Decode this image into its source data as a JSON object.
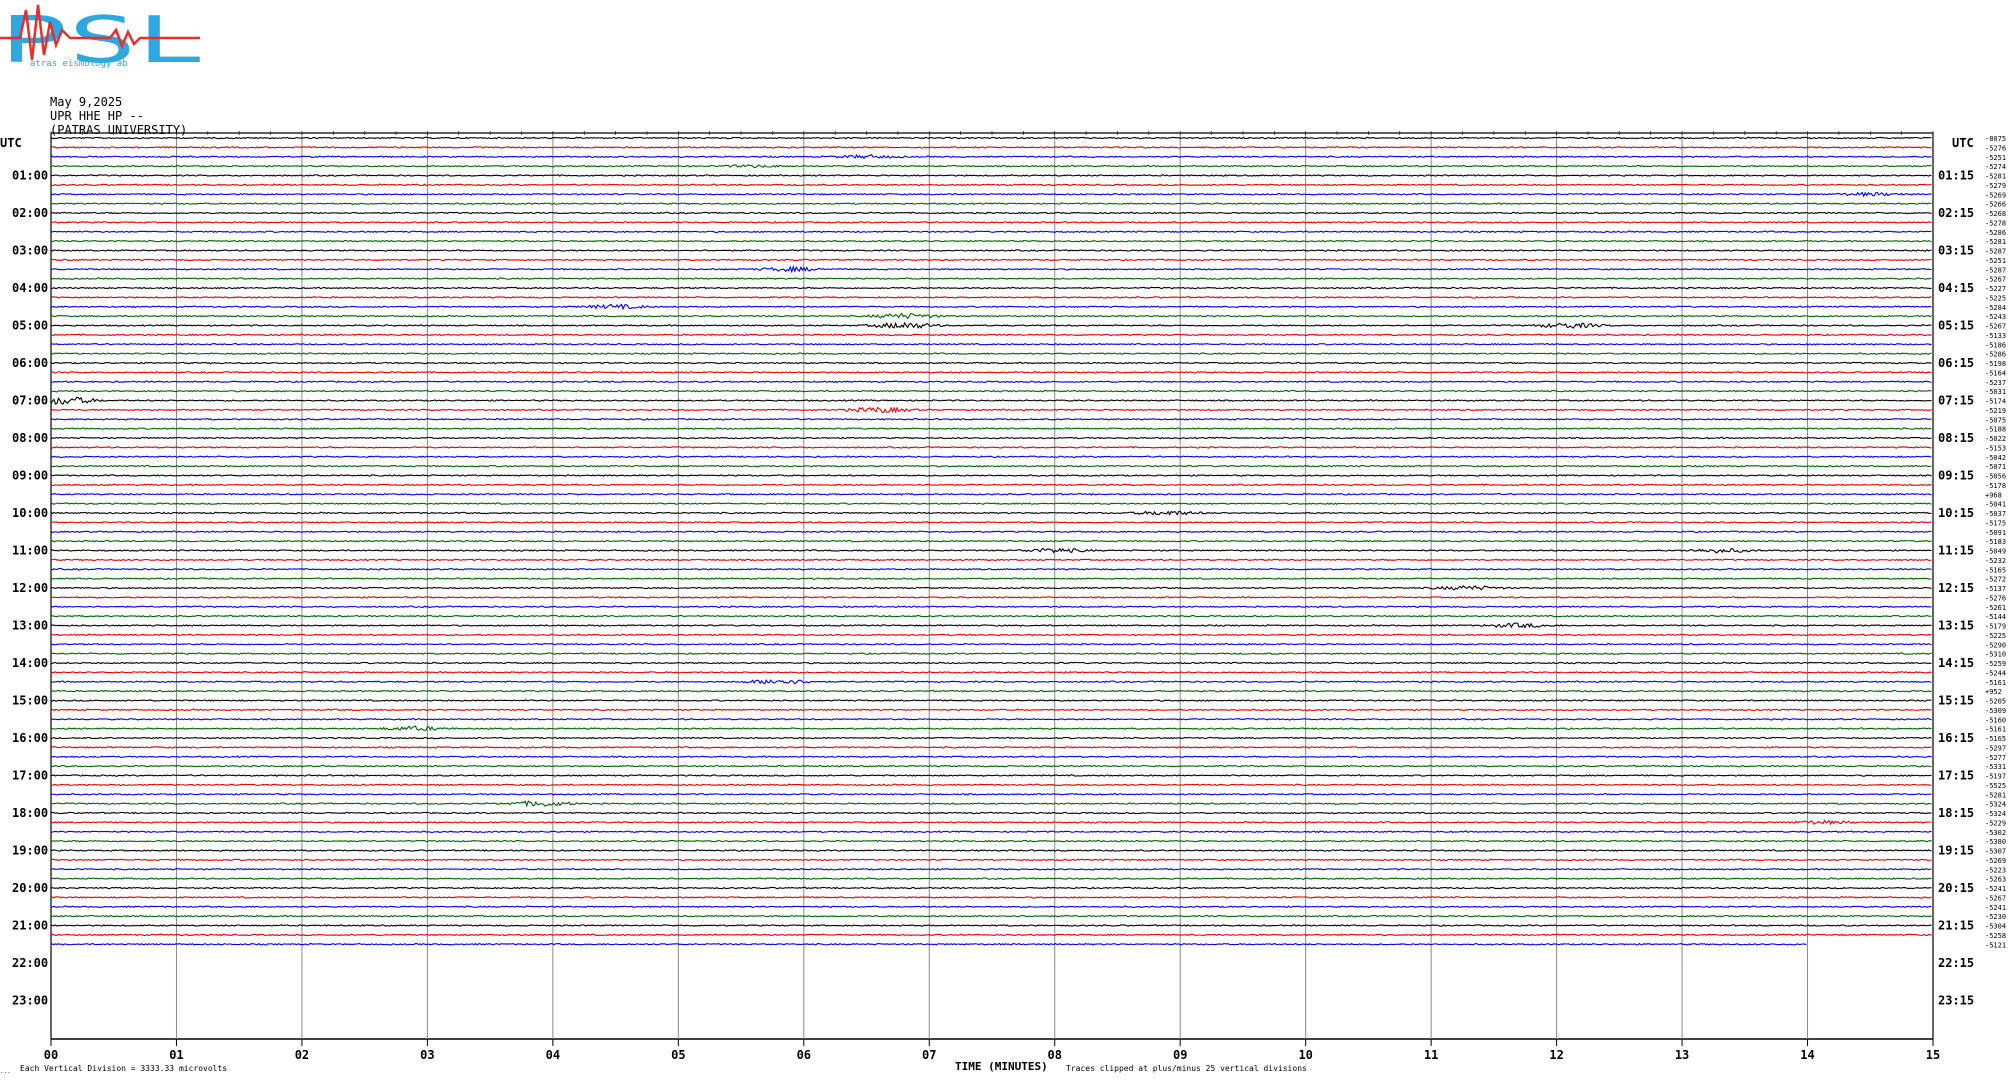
{
  "logo": {
    "letters": "PSL",
    "small_text": "atras eismology ab",
    "colors": {
      "p_s": "#2ea8e0",
      "l": "#2ea8e0",
      "wave": "#e03030"
    }
  },
  "header": {
    "date": "May 9,2025",
    "station": "UPR HHE HP --",
    "institution": "(PATRAS UNIVERSITY)"
  },
  "footer": {
    "scale_note": "Each Vertical Division = 3333.33 microvolts",
    "clip_note": "Traces clipped at plus/minus 25 vertical divisions",
    "corner_mark": "..."
  },
  "chart_data": {
    "type": "line",
    "title": "",
    "xlabel": "TIME (MINUTES)",
    "ylabel": "UTC",
    "right_ylabel": "UTC",
    "xlim": [
      0,
      15
    ],
    "x_ticks": [
      "00",
      "01",
      "02",
      "03",
      "04",
      "05",
      "06",
      "07",
      "08",
      "09",
      "10",
      "11",
      "12",
      "13",
      "14",
      "15"
    ],
    "left_hour_labels": [
      "01:00",
      "02:00",
      "03:00",
      "04:00",
      "05:00",
      "06:00",
      "07:00",
      "08:00",
      "09:00",
      "10:00",
      "11:00",
      "12:00",
      "13:00",
      "14:00",
      "15:00",
      "16:00",
      "17:00",
      "18:00",
      "19:00",
      "20:00",
      "21:00",
      "22:00",
      "23:00"
    ],
    "right_hour_labels": [
      "01:15",
      "02:15",
      "03:15",
      "04:15",
      "05:15",
      "06:15",
      "07:15",
      "08:15",
      "09:15",
      "10:15",
      "11:15",
      "12:15",
      "13:15",
      "14:15",
      "15:15",
      "16:15",
      "17:15",
      "18:15",
      "19:15",
      "20:15",
      "21:15",
      "22:15",
      "23:15"
    ],
    "trace_colors": [
      "#000000",
      "#e00000",
      "#0000e0",
      "#006400"
    ],
    "trace_count": 87,
    "last_trace_end_minute": 14.0,
    "right_values": [
      "-8075",
      "-5276",
      "-5251",
      "-5274",
      "-5281",
      "-5279",
      "-5269",
      "-5266",
      "-5268",
      "-5278",
      "-5286",
      "-5281",
      "-5287",
      "-5251",
      "-5287",
      "-5267",
      "-5227",
      "-5225",
      "-5284",
      "-5243",
      "-5267",
      "-5133",
      "-5186",
      "-5286",
      "-5198",
      "-5164",
      "-5237",
      "-5031",
      "-5174",
      "-5219",
      "-5075",
      "-5188",
      "-5022",
      "-5153",
      "-5042",
      "-5071",
      "-5056",
      "-5178",
      "+968",
      "-5041",
      "-5037",
      "-5175",
      "-5091",
      "-5183",
      "-5049",
      "-5232",
      "-5165",
      "-5272",
      "-5137",
      "-5276",
      "-5261",
      "-5144",
      "-5179",
      "-5225",
      "-5290",
      "-5310",
      "-5259",
      "-5244",
      "-5161",
      "+952",
      "-5205",
      "-5309",
      "-5160",
      "-5161",
      "-5165",
      "-5297",
      "-5277",
      "-5331",
      "-5197",
      "-5525",
      "-5281",
      "-5324",
      "-5324",
      "-5229",
      "-5302",
      "-5380",
      "-5307",
      "-5269",
      "-5223",
      "-5263",
      "-5241",
      "-5267",
      "-5241",
      "-5230",
      "-5304",
      "-5258",
      "-5121"
    ],
    "events": [
      {
        "trace": 2,
        "minute": 6.5,
        "amplitude": 3
      },
      {
        "trace": 3,
        "minute": 5.6,
        "amplitude": 2
      },
      {
        "trace": 6,
        "minute": 14.5,
        "amplitude": 3
      },
      {
        "trace": 14,
        "minute": 5.9,
        "amplitude": 4
      },
      {
        "trace": 18,
        "minute": 4.5,
        "amplitude": 4
      },
      {
        "trace": 19,
        "minute": 6.8,
        "amplitude": 5
      },
      {
        "trace": 20,
        "minute": 6.8,
        "amplitude": 6
      },
      {
        "trace": 20,
        "minute": 12.1,
        "amplitude": 5
      },
      {
        "trace": 28,
        "minute": 0.1,
        "amplitude": 8
      },
      {
        "trace": 29,
        "minute": 6.6,
        "amplitude": 5
      },
      {
        "trace": 40,
        "minute": 8.9,
        "amplitude": 4
      },
      {
        "trace": 44,
        "minute": 8.0,
        "amplitude": 4
      },
      {
        "trace": 44,
        "minute": 13.3,
        "amplitude": 4
      },
      {
        "trace": 48,
        "minute": 11.3,
        "amplitude": 4
      },
      {
        "trace": 52,
        "minute": 11.7,
        "amplitude": 4
      },
      {
        "trace": 58,
        "minute": 5.8,
        "amplitude": 5
      },
      {
        "trace": 63,
        "minute": 2.9,
        "amplitude": 4
      },
      {
        "trace": 71,
        "minute": 3.9,
        "amplitude": 5
      },
      {
        "trace": 73,
        "minute": 14.1,
        "amplitude": 3
      }
    ]
  }
}
